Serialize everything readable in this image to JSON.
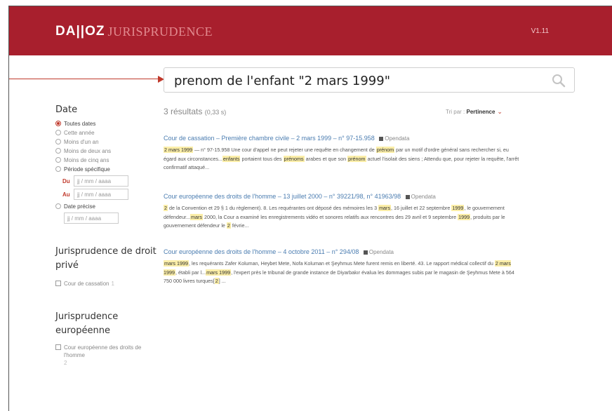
{
  "header": {
    "logo_brand": "DA||OZ",
    "logo_product": "JURISPRUDENCE",
    "version": "V1.11"
  },
  "search": {
    "query": "prenom de l'enfant \"2 mars 1999\""
  },
  "results_summary": {
    "count": "3 résultats",
    "time": "(0,33 s)",
    "sort_prefix": "Tri par :",
    "sort_value": "Pertinence"
  },
  "sidebar": {
    "date_title": "Date",
    "date_options": [
      {
        "label": "Toutes dates",
        "checked": true
      },
      {
        "label": "Cette année",
        "checked": false
      },
      {
        "label": "Moins d'un an",
        "checked": false
      },
      {
        "label": "Moins de deux ans",
        "checked": false
      },
      {
        "label": "Moins de cinq ans",
        "checked": false
      },
      {
        "label": "Période spécifique",
        "checked": false
      }
    ],
    "du_label": "Du",
    "au_label": "Au",
    "date_placeholder": "jj / mm / aaaa",
    "precise_label": "Date précise",
    "prive_title": "Jurisprudence de droit privé",
    "prive_items": [
      {
        "label": "Cour de cassation",
        "count": "1"
      }
    ],
    "euro_title": "Jurisprudence européenne",
    "euro_items": [
      {
        "label": "Cour européenne des droits de l'homme",
        "count": "2"
      }
    ]
  },
  "results": [
    {
      "title": "Cour de cassation – Première chambre civile – 2 mars 1999 – n° 97-15.958",
      "badge": "Opendata",
      "snippet_html": "<mark>2 mars 1999</mark> — n° 97-15.958 Une cour d'appel ne peut rejeter une requête en changement de <mark>prénom</mark> par un motif d'ordre général sans rechercher si, eu égard aux circonstances...<mark>enfants</mark> portaient tous des <mark>prénoms</mark> arabes et que son <mark>prénom</mark> actuel l'isolait des siens ; Attendu que, pour rejeter la requête, l'arrêt confirmatif attaqué..."
    },
    {
      "title": "Cour européenne des droits de l'homme – 13 juillet 2000 – n° 39221/98, n° 41963/98",
      "badge": "Opendata",
      "snippet_html": "<mark>2</mark> de la Convention et 29 § 1 du règlement). 8. Les requérantes ont déposé des mémoires les 3 <mark>mars</mark>, 16 juillet et 22 septembre <mark>1999</mark>, le gouvernement défendeur...<mark>mars</mark> 2000, la Cour a examiné les enregistrements vidéo et sonores relatifs aux rencontres des 29 avril et 9 septembre <mark>1999</mark>, produits par le gouvernement défendeur le <mark>2</mark> févrie..."
    },
    {
      "title": "Cour européenne des droits de l'homme – 4 octobre 2011 – n° 294/08",
      "badge": "Opendata",
      "snippet_html": "<mark>mars 1999</mark>, les requérants Zafer Koluman, Heybet Mete, Nofa Koluman et Şeyhmus Mete furent remis en liberté. 43. Le rapport médical collectif du <mark>2 mars 1999</mark>, établi par l...<mark>mars 1999</mark>, l'expert près le tribunal de grande instance de Diyarbakır évalua les dommages subis par le magasin de Şeyhmus Mete à 564 750 000 livres turques[<mark>2</mark>] ..."
    }
  ]
}
